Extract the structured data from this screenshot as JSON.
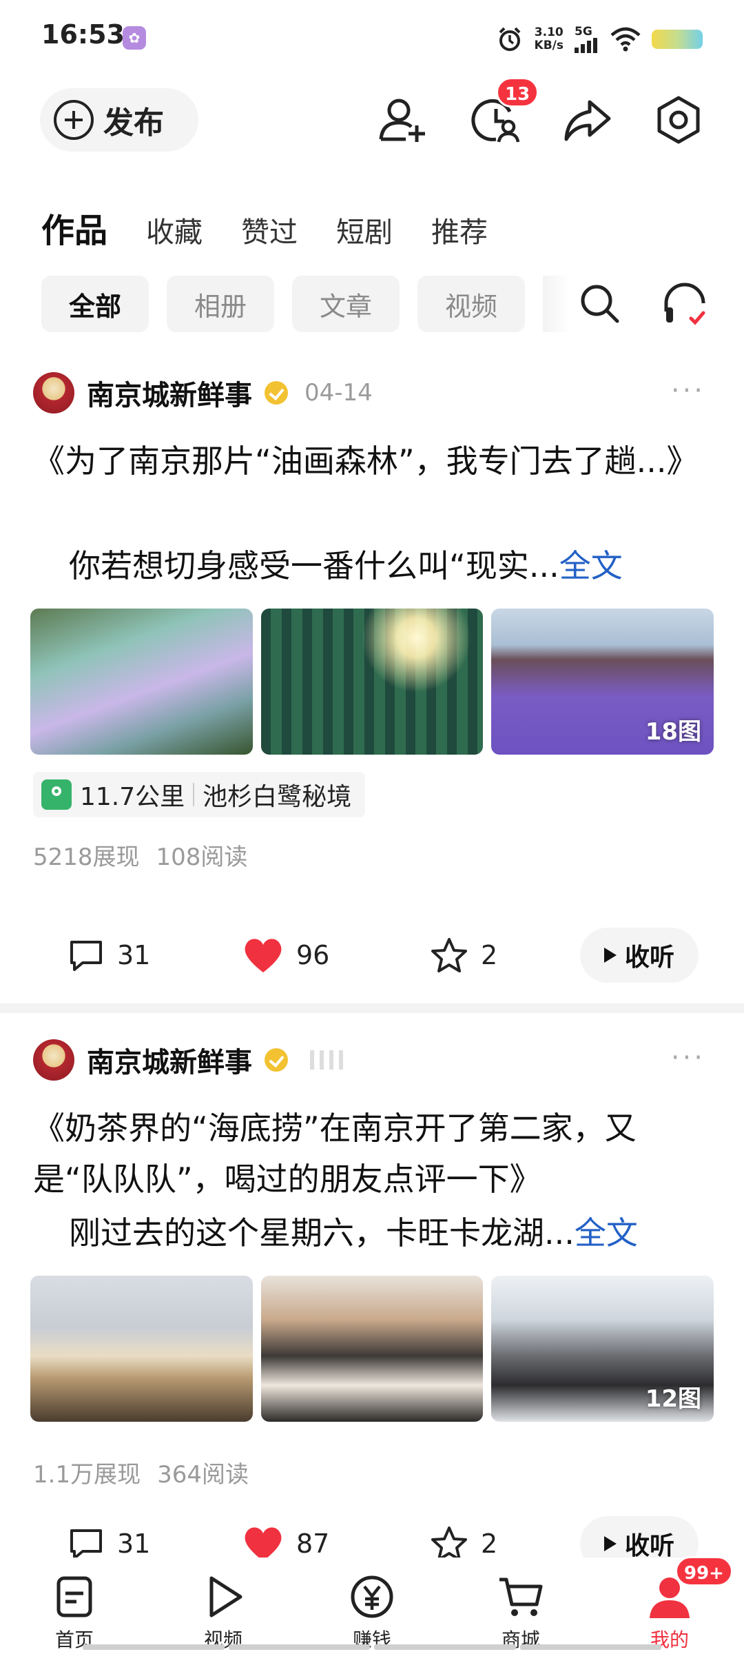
{
  "status_bar": {
    "time": "16:53",
    "net_speed_value": "3.10",
    "net_speed_unit": "KB/s",
    "network": "5G"
  },
  "top_bar": {
    "publish_label": "发布",
    "notification_badge": "13"
  },
  "tabs": [
    {
      "label": "作品",
      "active": true
    },
    {
      "label": "收藏",
      "active": false
    },
    {
      "label": "赞过",
      "active": false
    },
    {
      "label": "短剧",
      "active": false
    },
    {
      "label": "推荐",
      "active": false
    }
  ],
  "filters": [
    {
      "label": "全部",
      "active": true
    },
    {
      "label": "相册",
      "active": false
    },
    {
      "label": "文章",
      "active": false
    },
    {
      "label": "视频",
      "active": false
    }
  ],
  "posts": [
    {
      "author": "南京城新鲜事",
      "date": "04-14",
      "title": "《为了南京那片“油画森林”，我专门去了趟...》",
      "excerpt": "你若想切身感受一番什么叫“现实...",
      "full_text_link": "全文",
      "image_count": "18图",
      "location_distance": "11.7公里",
      "location_name": "池杉白鹭秘境",
      "impressions": "5218展现",
      "reads": "108阅读",
      "comments": "31",
      "likes": "96",
      "favorites": "2",
      "listen_label": "收听"
    },
    {
      "author": "南京城新鲜事",
      "date": "",
      "title": "《奶茶界的“海底捞”在南京开了第二家，又是“队队队”，喝过的朋友点评一下》",
      "excerpt": "刚过去的这个星期六，卡旺卡龙湖...",
      "full_text_link": "全文",
      "image_count": "12图",
      "impressions": "1.1万展现",
      "reads": "364阅读",
      "comments": "31",
      "likes": "87",
      "favorites": "2",
      "listen_label": "收听"
    }
  ],
  "bottom_nav": [
    {
      "label": "首页",
      "icon": "home-doc-icon"
    },
    {
      "label": "视频",
      "icon": "play-icon"
    },
    {
      "label": "赚钱",
      "icon": "yuan-coin-icon"
    },
    {
      "label": "商城",
      "icon": "cart-icon"
    },
    {
      "label": "我的",
      "icon": "profile-icon",
      "active": true,
      "badge": "99+"
    }
  ],
  "colors": {
    "accent_red": "#f0313f",
    "link_blue": "#2361c6",
    "verify_gold": "#f2c232",
    "location_green": "#35b36a"
  }
}
